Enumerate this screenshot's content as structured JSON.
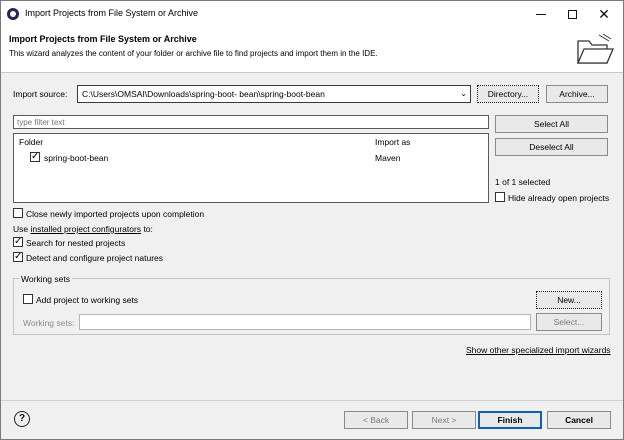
{
  "window": {
    "title": "Import Projects from File System or Archive"
  },
  "header": {
    "title": "Import Projects from File System or Archive",
    "description": "This wizard analyzes the content of your folder or archive file to find projects and import them in the IDE."
  },
  "source": {
    "label": "Import source:",
    "value": "C:\\Users\\OMSAI\\Downloads\\spring-boot- bean\\spring-boot-bean",
    "directory_button": "Directory...",
    "archive_button": "Archive..."
  },
  "filter": {
    "placeholder": "type filter text"
  },
  "table": {
    "col_folder": "Folder",
    "col_import_as": "Import as",
    "rows": [
      {
        "folder": "spring-boot-bean",
        "import_as": "Maven",
        "checked": true
      }
    ]
  },
  "side": {
    "select_all": "Select All",
    "deselect_all": "Deselect All",
    "selected_count": "1 of 1 selected",
    "hide_open": "Hide already open projects"
  },
  "options": {
    "close_newly": "Close newly imported projects upon completion",
    "use_prefix": "Use",
    "installed_link": "installed project configurators",
    "use_suffix": "to:",
    "search_nested": "Search for nested projects",
    "detect_configure": "Detect and configure project natures"
  },
  "working_sets": {
    "legend": "Working sets",
    "add_label": "Add project to working sets",
    "new_button": "New...",
    "sets_label": "Working sets:",
    "select_button": "Select..."
  },
  "show_other_link": "Show other specialized import wizards",
  "footer": {
    "help": "?",
    "back": "< Back",
    "next": "Next >",
    "finish": "Finish",
    "cancel": "Cancel"
  }
}
